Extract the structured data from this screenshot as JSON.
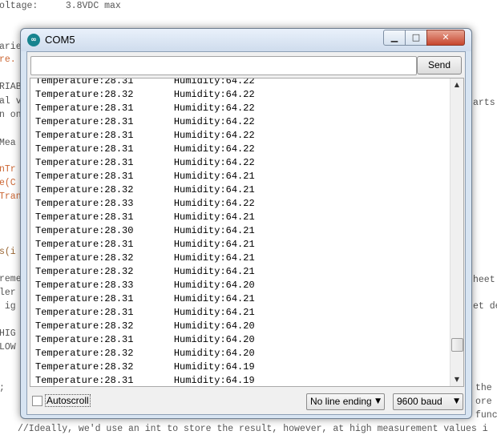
{
  "background_code": {
    "lines": [
      {
        "text": "oltage:     3.8VDC max",
        "cls": ""
      },
      {
        "text": "arie",
        "cls": ""
      },
      {
        "text": "re.",
        "cls": "kw-orange"
      },
      {
        "text": "RIAB",
        "cls": ""
      },
      {
        "text": "al v",
        "cls": ""
      },
      {
        "text": "n on",
        "cls": ""
      },
      {
        "text": "Mea",
        "cls": ""
      },
      {
        "text": "nTr",
        "cls": "kw-orange"
      },
      {
        "text": "e(C",
        "cls": "kw-orange"
      },
      {
        "text": "Tran",
        "cls": "kw-orange"
      },
      {
        "text": "s(i",
        "cls": "kw-brown"
      },
      {
        "text": "reme",
        "cls": ""
      },
      {
        "text": "ler",
        "cls": ""
      },
      {
        "text": " ig",
        "cls": ""
      },
      {
        "text": "HIG",
        "cls": ""
      },
      {
        "text": "LOW",
        "cls": ""
      },
      {
        "text": ";",
        "cls": ""
      },
      {
        "text": "//Ideally, we'd use an int to store the result, however, at high measurement values i",
        "cls": ""
      }
    ],
    "right_fragments": [
      "arts",
      "heet",
      "et de",
      "the",
      "ore",
      "funct"
    ]
  },
  "window": {
    "title": "COM5",
    "icon": "arduino-icon",
    "controls": {
      "minimize": "minimize-icon",
      "maximize": "maximize-icon",
      "close": "close-icon"
    }
  },
  "send": {
    "input_value": "",
    "button_label": "Send"
  },
  "serial_output": [
    "Temperature:28.31       Humidity:64.22",
    "Temperature:28.32       Humidity:64.22",
    "Temperature:28.31       Humidity:64.22",
    "Temperature:28.31       Humidity:64.22",
    "Temperature:28.31       Humidity:64.22",
    "Temperature:28.31       Humidity:64.22",
    "Temperature:28.31       Humidity:64.22",
    "Temperature:28.31       Humidity:64.21",
    "Temperature:28.32       Humidity:64.21",
    "Temperature:28.33       Humidity:64.22",
    "Temperature:28.31       Humidity:64.21",
    "Temperature:28.30       Humidity:64.21",
    "Temperature:28.31       Humidity:64.21",
    "Temperature:28.32       Humidity:64.21",
    "Temperature:28.32       Humidity:64.21",
    "Temperature:28.33       Humidity:64.20",
    "Temperature:28.31       Humidity:64.21",
    "Temperature:28.31       Humidity:64.21",
    "Temperature:28.32       Humidity:64.20",
    "Temperature:28.31       Humidity:64.20",
    "Temperature:28.32       Humidity:64.20",
    "Temperature:28.32       Humidity:64.19",
    "Temperature:28.31       Humidity:64.19"
  ],
  "footer": {
    "autoscroll_label": "Autoscroll",
    "autoscroll_checked": false,
    "line_ending": "No line ending",
    "baud_rate": "9600 baud"
  },
  "colors": {
    "close_button": "#c7472e",
    "arduino_teal": "#17848f",
    "title_gradient_top": "#e9f1fb"
  }
}
